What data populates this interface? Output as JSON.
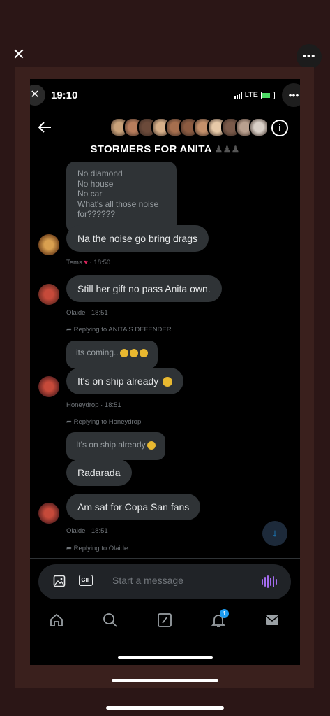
{
  "viewer": {
    "close_icon": "close-icon",
    "more_icon": "more-icon"
  },
  "status_bar": {
    "time": "19:10",
    "network": "LTE"
  },
  "header": {
    "title": "STORMERS FOR ANITA",
    "title_suffix": "♟♟♟",
    "avatar_colors": [
      "#c9a27a",
      "#b87d5c",
      "#6b4a3a",
      "#d7b08a",
      "#a66f4e",
      "#8c5b41",
      "#c4906b",
      "#e6c9a8",
      "#7a5a4a",
      "#b9a08f",
      "#d9d0c8"
    ]
  },
  "messages": {
    "quoted_lines": [
      "No diamond",
      "No house",
      "No car",
      "What's all those noise",
      "for??????"
    ],
    "msg1": {
      "text": "Na the noise  go bring drags",
      "meta": "Tems",
      "meta_time": "· 18:50"
    },
    "msg2": {
      "text": "Still her gift no pass Anita own.",
      "meta": "Olaide · 18:51"
    },
    "reply1": "Replying to ANITA'S DEFENDER",
    "quote2": "its coming..",
    "msg3": {
      "text": "It's on ship already",
      "meta": "Honeydrop · 18:51"
    },
    "reply2": "Replying to Honeydrop",
    "quote3": "It's on ship already",
    "msg4": {
      "text": "Radarada"
    },
    "msg5": {
      "text": "Am sat for Copa San fans",
      "meta": "Olaide · 18:51"
    },
    "reply3": "Replying to Olaide"
  },
  "composer": {
    "placeholder": "Start a message",
    "gif_label": "GIF"
  },
  "nav": {
    "notification_count": "1"
  },
  "colors": {
    "bubble": "#2f3336",
    "accent": "#1d9bf0",
    "voice": "#a46cf0"
  }
}
